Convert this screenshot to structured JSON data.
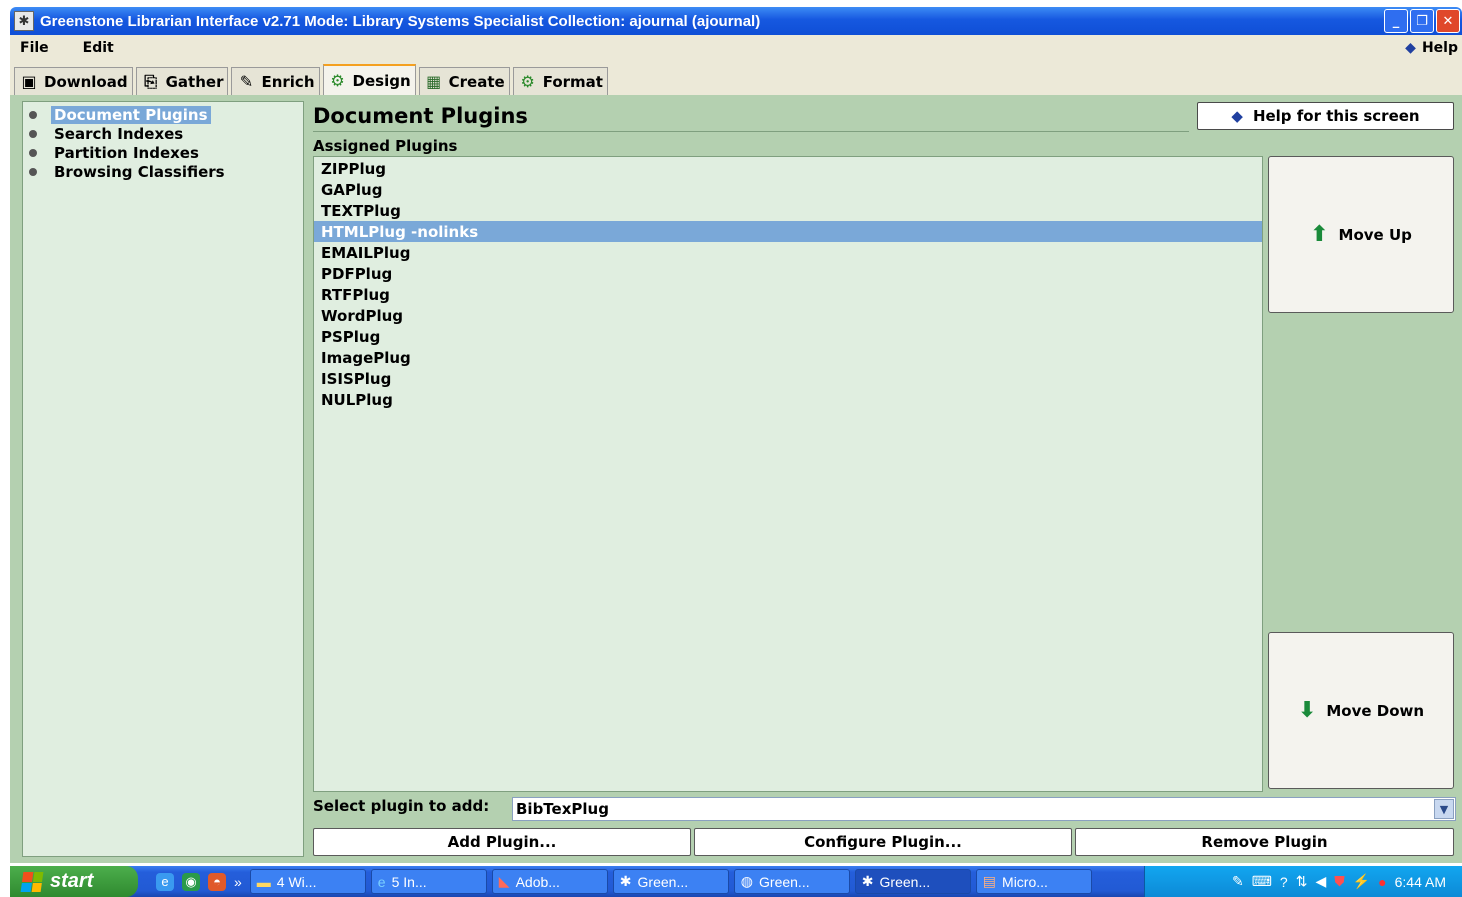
{
  "window": {
    "title": "Greenstone Librarian Interface v2.71  Mode: Library Systems Specialist  Collection: ajournal (ajournal)",
    "minimize": "_",
    "maximize": "❐",
    "close": "✕"
  },
  "menubar": {
    "file": "File",
    "edit": "Edit",
    "help": "Help"
  },
  "tabs": [
    {
      "label": "Download",
      "icon": "download-icon"
    },
    {
      "label": "Gather",
      "icon": "gather-icon"
    },
    {
      "label": "Enrich",
      "icon": "enrich-icon"
    },
    {
      "label": "Design",
      "icon": "gear-icon",
      "active": true
    },
    {
      "label": "Create",
      "icon": "create-icon"
    },
    {
      "label": "Format",
      "icon": "gear-icon"
    }
  ],
  "sidebar": {
    "items": [
      {
        "label": "Document Plugins",
        "selected": true
      },
      {
        "label": "Search Indexes"
      },
      {
        "label": "Partition Indexes"
      },
      {
        "label": "Browsing Classifiers"
      }
    ]
  },
  "panel": {
    "title": "Document Plugins",
    "help_button": "Help for this screen",
    "assigned_label": "Assigned Plugins",
    "plugins": [
      "ZIPPlug",
      "GAPlug",
      "TEXTPlug",
      "HTMLPlug -nolinks",
      "EMAILPlug",
      "PDFPlug",
      "RTFPlug",
      "WordPlug",
      "PSPlug",
      "ImagePlug",
      "ISISPlug",
      "NULPlug"
    ],
    "selected_plugin": "HTMLPlug -nolinks",
    "move_up": "Move Up",
    "move_down": "Move Down",
    "select_label": "Select plugin to add:",
    "select_value": "BibTexPlug",
    "add_button": "Add Plugin...",
    "configure_button": "Configure Plugin...",
    "remove_button": "Remove Plugin"
  },
  "taskbar": {
    "start": "start",
    "chevron": "»",
    "tasks": [
      {
        "label": "4 Wi...",
        "icon": "folder-icon"
      },
      {
        "label": "5 In...",
        "icon": "ie-icon"
      },
      {
        "label": "Adob...",
        "icon": "adobe-icon"
      },
      {
        "label": "Green...",
        "icon": "greenstone-icon"
      },
      {
        "label": "Green...",
        "icon": "globe-icon"
      },
      {
        "label": "Green...",
        "icon": "greenstone-icon",
        "active": true
      },
      {
        "label": "Micro...",
        "icon": "powerpoint-icon"
      }
    ],
    "clock": "6:44 AM"
  },
  "colors": {
    "panel_bg": "#b4d0b0",
    "list_bg": "#e0eee0",
    "selection": "#7aa8d8",
    "titlebar": "#1658e0"
  }
}
